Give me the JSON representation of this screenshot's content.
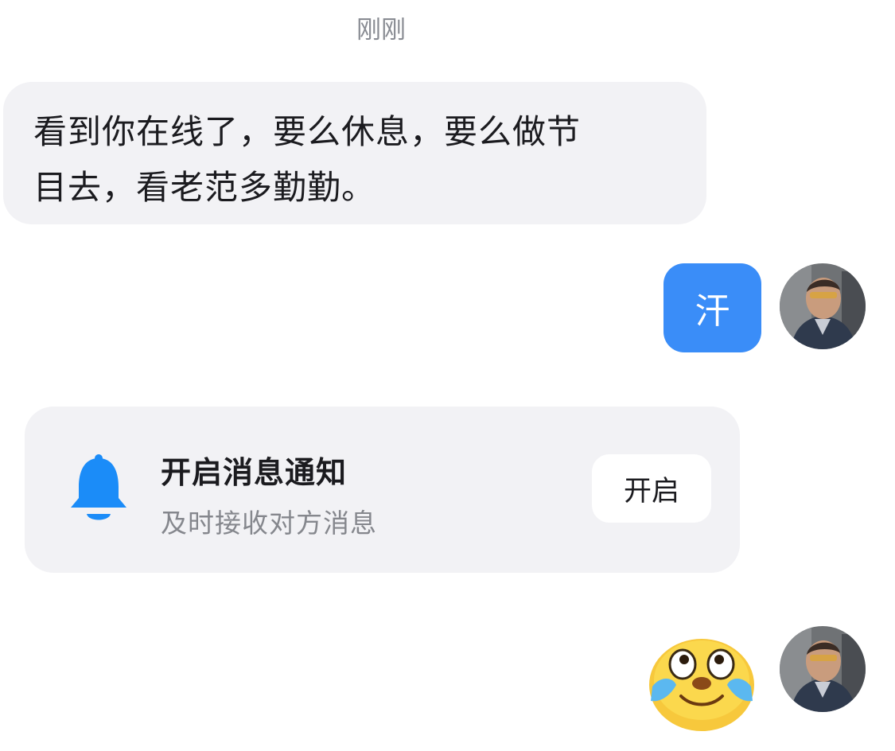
{
  "timestamp": "刚刚",
  "messages": [
    {
      "direction": "incoming",
      "lines": [
        "看到你在线了，要么休息，要么做节",
        "目去，看老范多勤勤。"
      ]
    },
    {
      "direction": "outgoing",
      "text": "汗"
    },
    {
      "direction": "outgoing",
      "sticker": "crying-laughing-emoji"
    }
  ],
  "notification_card": {
    "icon": "bell-icon",
    "title": "开启消息通知",
    "subtitle": "及时接收对方消息",
    "button_label": "开启"
  },
  "colors": {
    "outgoing_bubble": "#3a8df8",
    "incoming_bubble": "#f2f2f5",
    "bell_icon": "#1b8cf8",
    "subtitle_text": "#85878d"
  }
}
